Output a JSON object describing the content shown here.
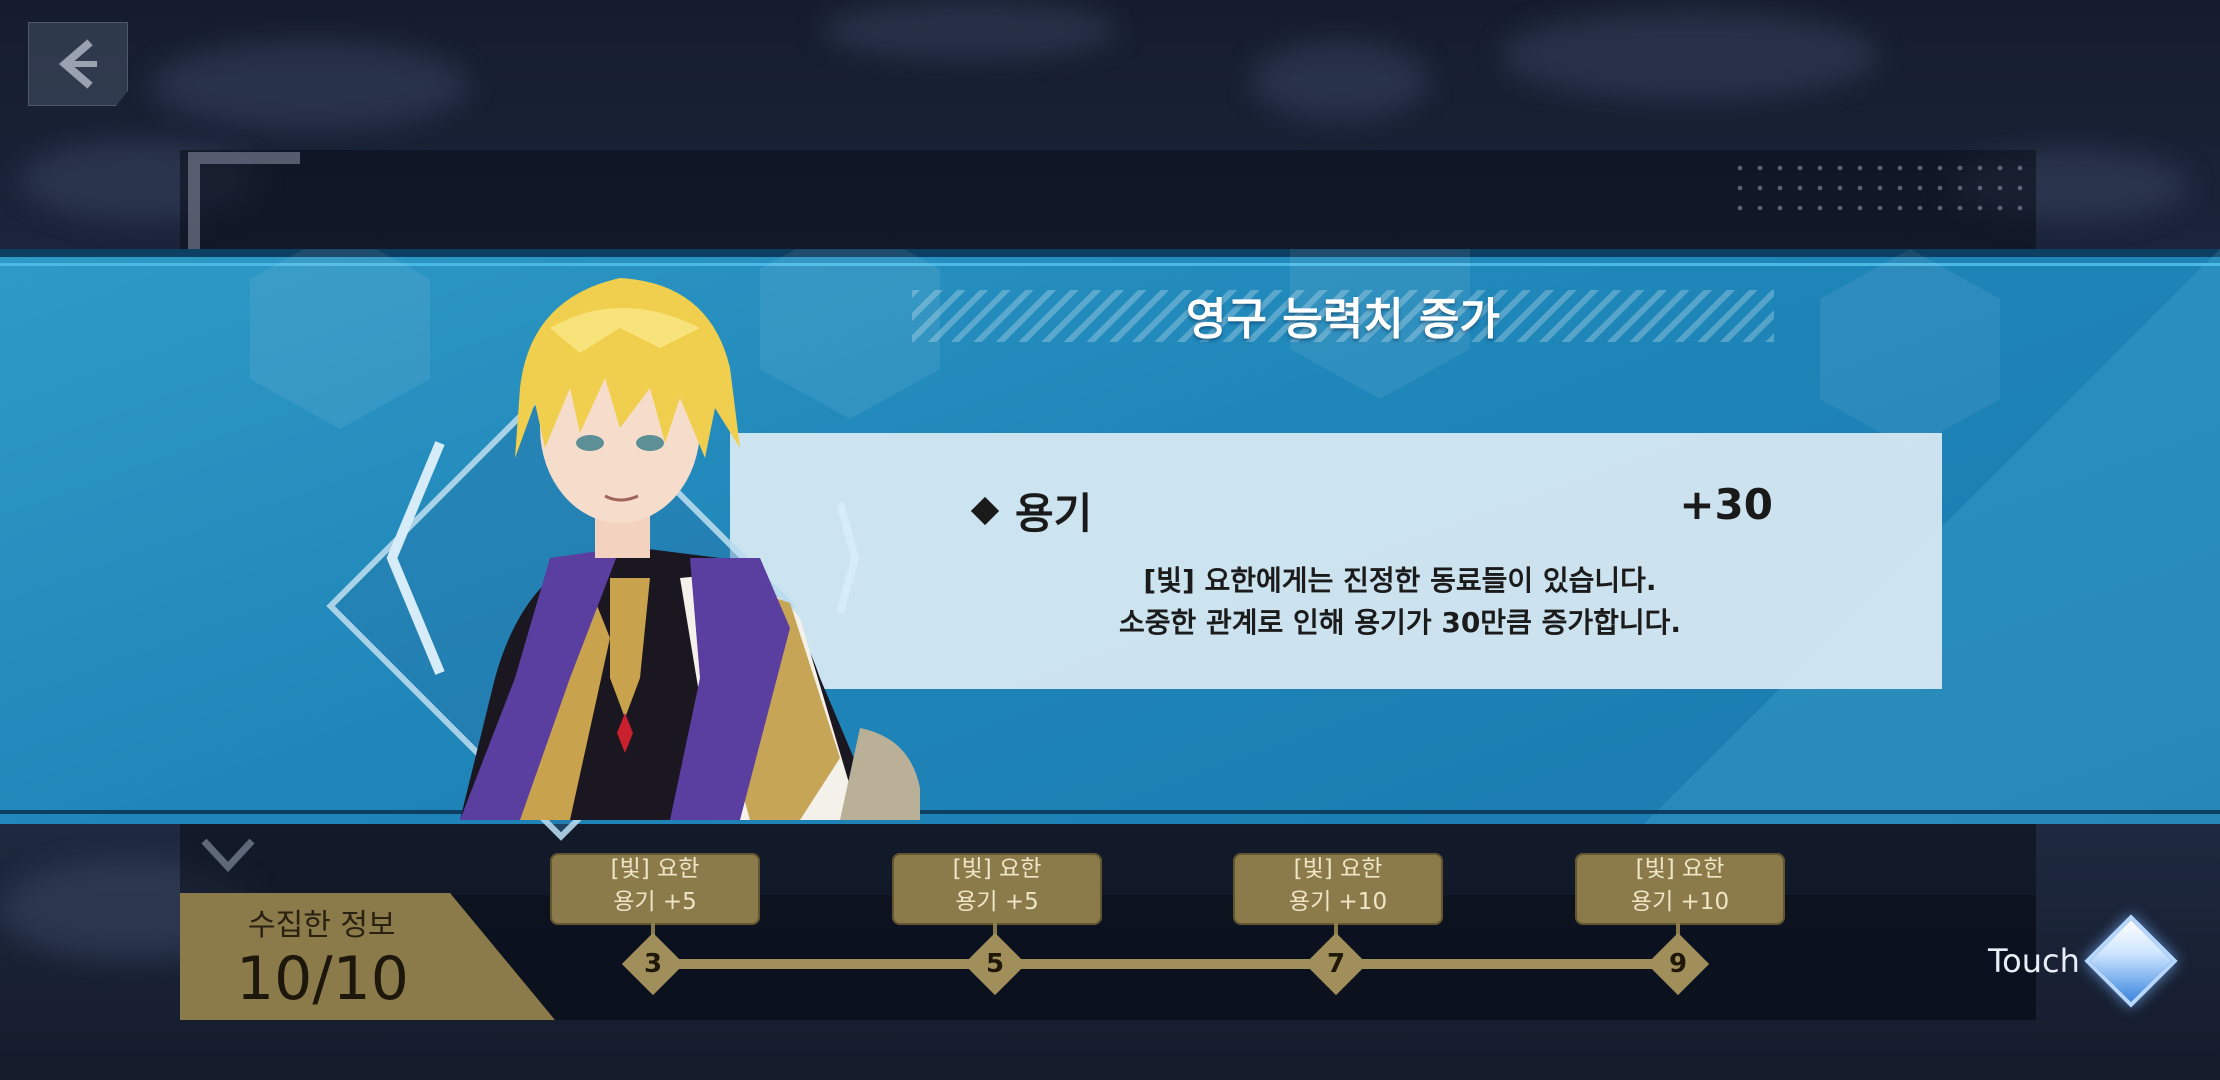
{
  "header": {
    "back_icon": "chevron-left-icon"
  },
  "popup": {
    "title": "영구 능력치 증가",
    "stat_name": "용기",
    "stat_value": "+30",
    "description_line1": "[빛] 요한에게는 진정한 동료들이 있습니다.",
    "description_line2": "소중한 관계로 인해 용기가 30만큼 증가합니다."
  },
  "collection": {
    "label": "수집한 정보",
    "count": "10/10",
    "milestones": [
      {
        "node": "3",
        "line1": "[빛] 요한",
        "line2": "용기 +5"
      },
      {
        "node": "5",
        "line1": "[빛] 요한",
        "line2": "용기 +5"
      },
      {
        "node": "7",
        "line1": "[빛] 요한",
        "line2": "용기 +10"
      },
      {
        "node": "9",
        "line1": "[빛] 요한",
        "line2": "용기 +10"
      }
    ]
  },
  "prompt": {
    "touch_label": "Touch",
    "touch_icon": "diamond-icon"
  },
  "colors": {
    "band": "#1f86b9",
    "panel": "#d6e8f2",
    "gold": "#8b7a4a"
  }
}
